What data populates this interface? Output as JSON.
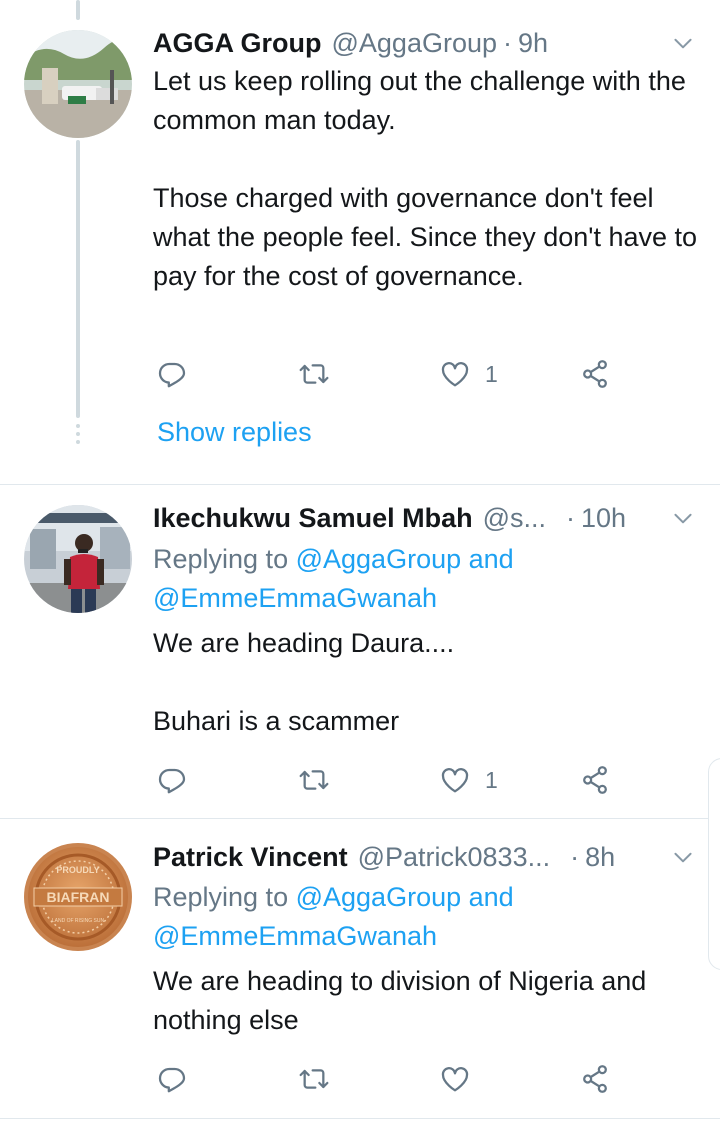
{
  "tweets": [
    {
      "name": "AGGA Group",
      "handle": "@AggaGroup",
      "separator": "·",
      "time": "9h",
      "text": "Let us keep rolling out the challenge with the common man today.\n\nThose charged with governance don't feel what the people feel. Since they don't have to pay for the cost of governance.",
      "like_count": "1",
      "show_replies": "Show replies"
    },
    {
      "name": "Ikechukwu Samuel Mbah",
      "handle": "@s...",
      "separator": "·",
      "time": "10h",
      "replying_prefix": "Replying to",
      "replying_user1": "@AggaGroup",
      "replying_and": "and",
      "replying_user2": "@EmmeEmmaGwanah",
      "text": "We are heading Daura....\n\nBuhari is a scammer",
      "like_count": "1"
    },
    {
      "name": "Patrick Vincent",
      "handle": "@Patrick0833...",
      "separator": "·",
      "time": "8h",
      "replying_prefix": "Replying to",
      "replying_user1": "@AggaGroup",
      "replying_and": "and",
      "replying_user2": "@EmmeEmmaGwanah",
      "text": "We are heading to division of Nigeria and nothing else",
      "like_count": ""
    }
  ],
  "avatar_badge": {
    "line1": "PROUDLY",
    "line2": "BIAFRAN",
    "line3": "LAND OF RISING SUN"
  },
  "colors": {
    "link": "#1da1f2",
    "secondary_text": "#657786",
    "thread_line": "#cfd9de",
    "divider": "#e1e8ed"
  },
  "icons": [
    "chevron-down-icon",
    "reply-icon",
    "retweet-icon",
    "like-icon",
    "share-icon"
  ]
}
